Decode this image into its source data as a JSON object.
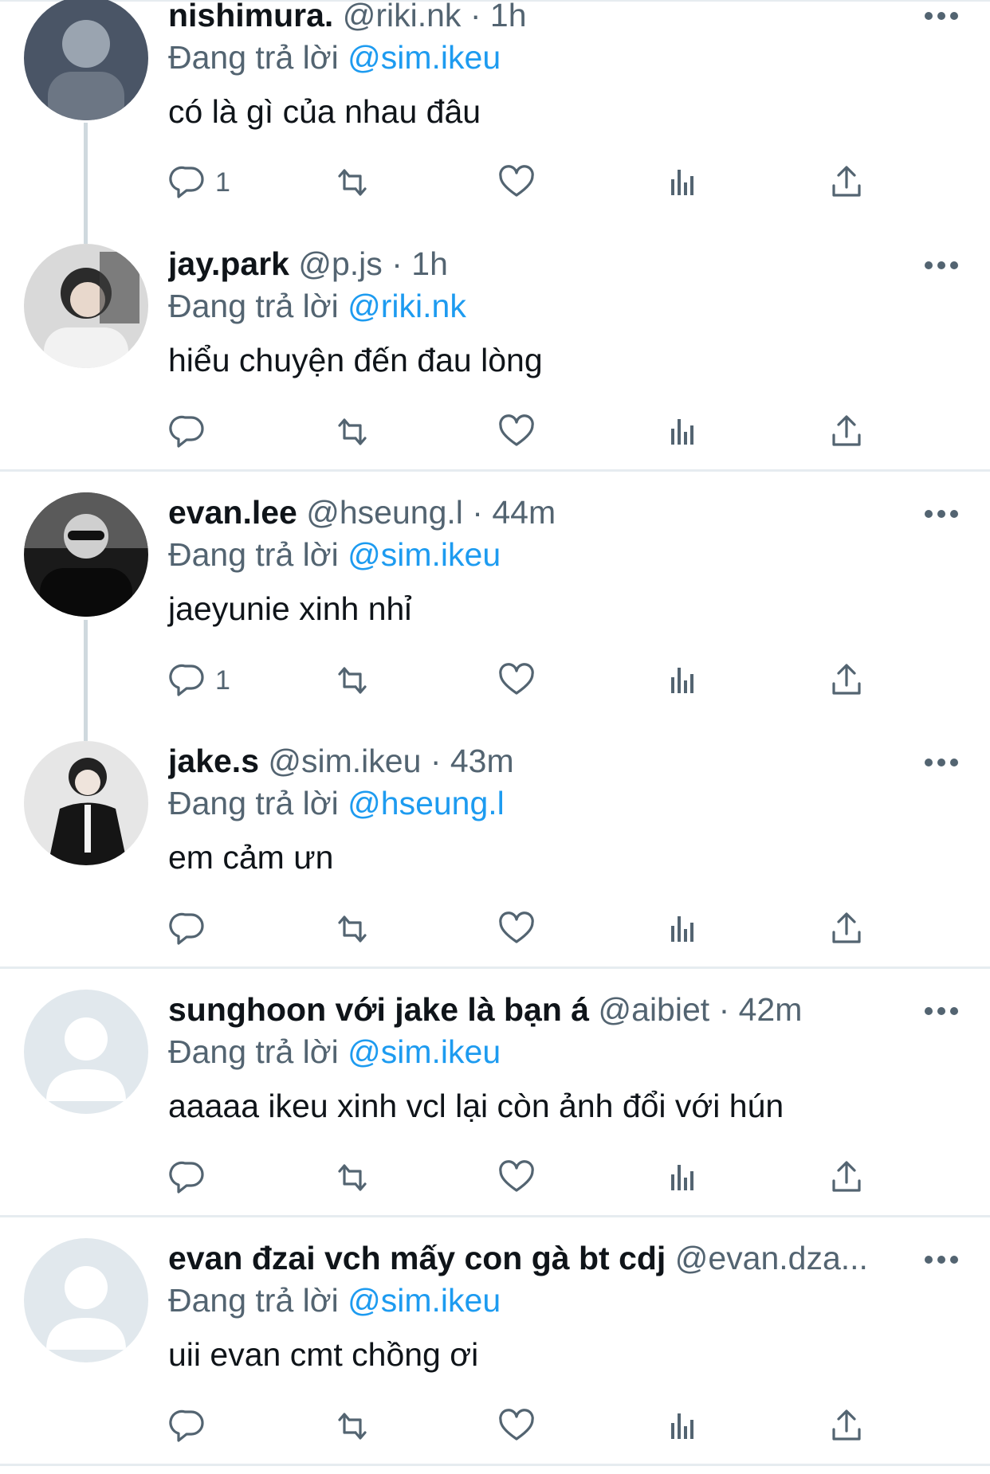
{
  "colors": {
    "accent": "#1d9bf0",
    "secondary_text": "#536471",
    "primary_text": "#0f1419",
    "divider": "#e6ecf0",
    "thread_line": "#cfd9de"
  },
  "reply_prefix": "Đang trả lời",
  "tweets": [
    {
      "name": "nishimura.",
      "handle": "@riki.nk",
      "sep": "·",
      "time": "1h",
      "reply_to": "@sim.ikeu",
      "text": "có là gì của nhau đâu",
      "reply_count": "1"
    },
    {
      "name": "jay.park",
      "handle": "@p.js",
      "sep": "·",
      "time": "1h",
      "reply_to": "@riki.nk",
      "text": "hiểu chuyện đến đau lòng",
      "reply_count": ""
    },
    {
      "name": "evan.lee",
      "handle": "@hseung.l",
      "sep": "·",
      "time": "44m",
      "reply_to": "@sim.ikeu",
      "text": "jaeyunie xinh nhỉ",
      "reply_count": "1"
    },
    {
      "name": "jake.s",
      "handle": "@sim.ikeu",
      "sep": "·",
      "time": "43m",
      "reply_to": "@hseung.l",
      "text": "em cảm ưn",
      "reply_count": ""
    },
    {
      "name": "sunghoon với jake là bạn á",
      "handle": "@aibiet",
      "sep": "·",
      "time": "42m",
      "reply_to": "@sim.ikeu",
      "text": "aaaaa ikeu xinh vcl lại còn ảnh đổi với hún",
      "reply_count": ""
    },
    {
      "name": "evan đzai vch mấy con gà bt cdj",
      "handle": "@evan.dza...",
      "sep": "",
      "time": "",
      "reply_to": "@sim.ikeu",
      "text": "uii evan cmt chồng ơi",
      "reply_count": ""
    }
  ],
  "icons": {
    "more": "more-horizontal-icon",
    "reply": "reply-bubble-icon",
    "retweet": "retweet-icon",
    "like": "heart-icon",
    "views": "views-bar-chart-icon",
    "share": "share-upload-icon"
  }
}
